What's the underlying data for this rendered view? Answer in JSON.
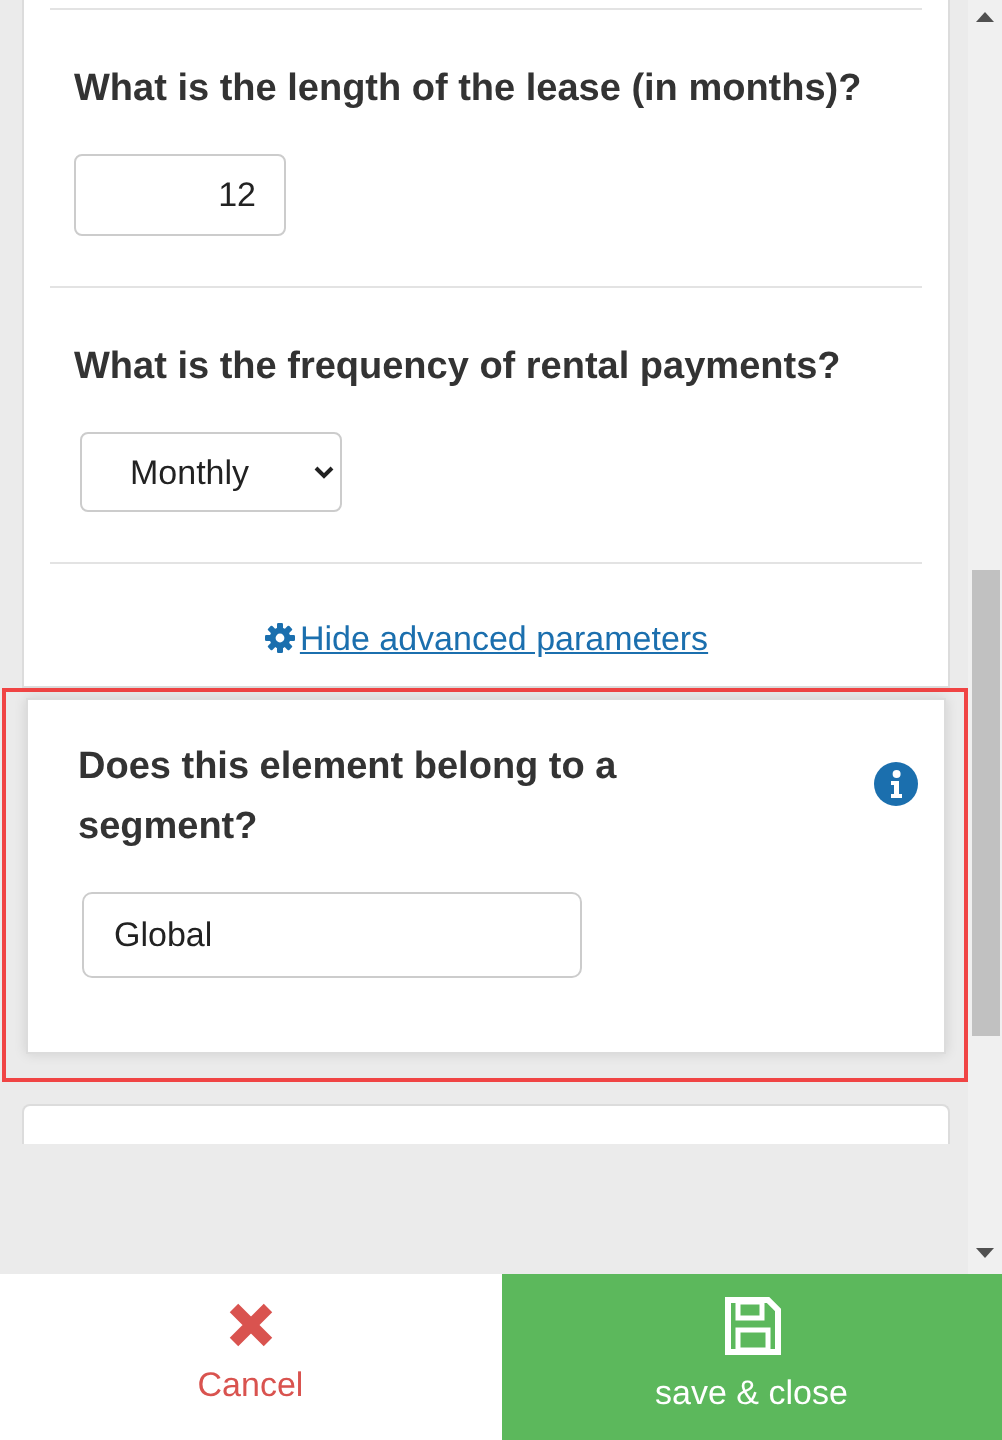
{
  "questions": [
    {
      "kind": "number",
      "label": "What is the length of the lease (in months)?",
      "value": "12"
    },
    {
      "kind": "select",
      "label": "What is the frequency of rental payments?",
      "value": "Monthly"
    }
  ],
  "advanced_toggle": {
    "label": "Hide advanced parameters"
  },
  "segment_question": {
    "label": "Does this element belong to a segment?",
    "value": "Global",
    "highlighted": true
  },
  "footer_buttons": [
    {
      "kind": "cancel",
      "label": "Cancel"
    },
    {
      "kind": "save",
      "label": "save & close"
    }
  ]
}
